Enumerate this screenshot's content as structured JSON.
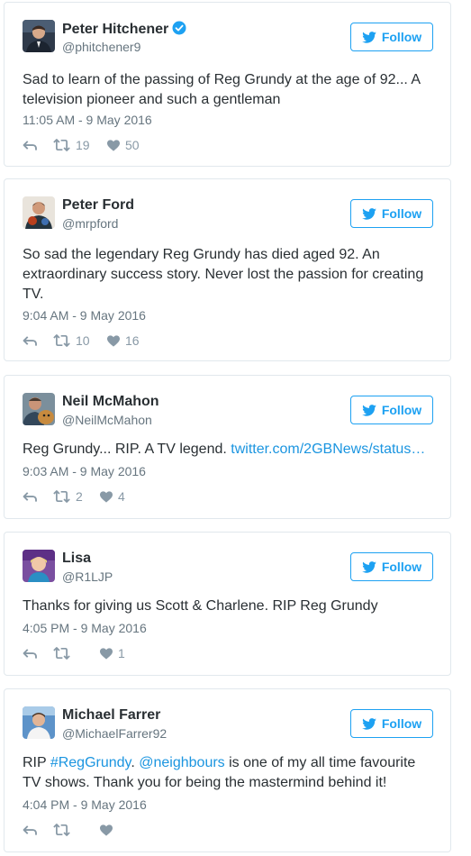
{
  "colors": {
    "accent": "#1da1f2",
    "link": "#1b95e0",
    "text": "#292f33",
    "muted": "#66757f",
    "action": "#8899a6",
    "border": "#e1e8ed"
  },
  "follow_label": "Follow",
  "tweets": [
    {
      "name": "Peter Hitchener",
      "verified": true,
      "handle": "@phitchener9",
      "text": "Sad to learn of the passing of Reg Grundy at the age of 92... A television pioneer and such a gentleman",
      "time": "11:05 AM - 9 May 2016",
      "retweets": "19",
      "likes": "50"
    },
    {
      "name": "Peter Ford",
      "handle": "@mrpford",
      "text": "So sad the legendary Reg Grundy has died aged 92. An extraordinary success story. Never lost the passion for creating TV.",
      "time": "9:04 AM - 9 May 2016",
      "retweets": "10",
      "likes": "16"
    },
    {
      "name": "Neil McMahon",
      "handle": "@NeilMcMahon",
      "text": "Reg Grundy... RIP. A TV legend.",
      "link": "twitter.com/2GBNews/status…",
      "time": "9:03 AM - 9 May 2016",
      "retweets": "2",
      "likes": "4"
    },
    {
      "name": "Lisa",
      "handle": "@R1LJP",
      "text": "Thanks for giving us Scott & Charlene. RIP Reg Grundy",
      "time": "4:05 PM - 9 May 2016",
      "retweets": "",
      "likes": "1"
    },
    {
      "name": "Michael Farrer",
      "handle": "@MichaelFarrer92",
      "text_parts": {
        "p1": "RIP ",
        "hashtag": "#RegGrundy",
        "p2": ". ",
        "mention": "@neighbours",
        "p3": " is one of my all time favourite TV shows. Thank you for being the mastermind behind it!"
      },
      "time": "4:04 PM - 9 May 2016",
      "retweets": "",
      "likes": ""
    }
  ],
  "icons": {
    "reply": "reply-icon",
    "retweet": "retweet-icon",
    "like": "heart-icon",
    "follow": "twitter-bird-icon",
    "verified": "verified-badge-icon"
  }
}
